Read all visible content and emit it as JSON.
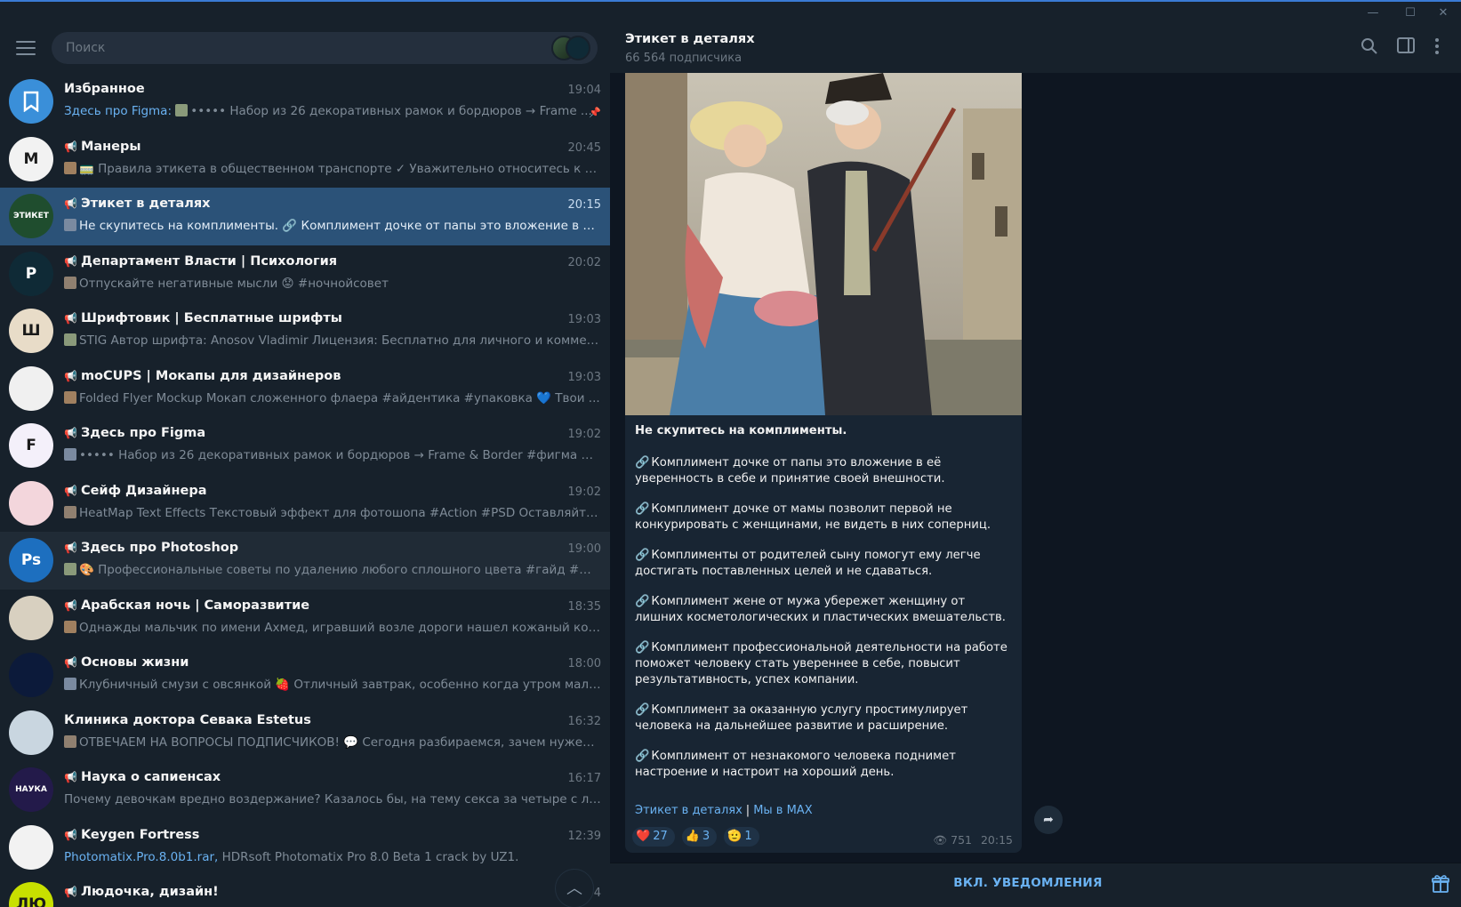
{
  "search": {
    "placeholder": "Поиск"
  },
  "chats": [
    {
      "name": "Избранное",
      "time": "19:04",
      "prefix": "Здесь про Figma:",
      "preview": "••••• Набор из 26 декоративных рамок и бордюров → Frame ...",
      "channel": false,
      "avatar_color": "#3a8fd9",
      "avatar_icon": "bookmark-icon"
    },
    {
      "name": "Манеры",
      "time": "20:45",
      "prefix": "",
      "preview": "🚃 Правила этикета в общественном транспорте ✓ Уважительно относитесь к другим па...",
      "channel": true,
      "avatar_color": "#f2f2f2",
      "avatar_text": "M"
    },
    {
      "name": "Этикет в деталях",
      "time": "20:15",
      "prefix": "",
      "preview": "Не скупитесь на комплименты. 🔗 Комплимент дочке от папы это вложение в её увере...",
      "channel": true,
      "avatar_color": "#1f4d2e",
      "avatar_text": "ЭТИКЕТ"
    },
    {
      "name": "Департамент Власти | Психология",
      "time": "20:02",
      "prefix": "",
      "preview": "Отпускайте негативные мысли 😟 #ночнойсовет",
      "channel": true,
      "avatar_color": "#0f2a36",
      "avatar_text": "P"
    },
    {
      "name": "Шрифтовик | Бесплатные шрифты",
      "time": "19:03",
      "prefix": "",
      "preview": "STIG Автор шрифта: Anosov Vladimir Лицензия: Бесплатно для личного и коммер...",
      "channel": true,
      "avatar_color": "#e8dcc8",
      "avatar_text": "Ш"
    },
    {
      "name": "moCUPS | Мокапы для дизайнеров",
      "time": "19:03",
      "prefix": "",
      "preview": "Folded Flyer Mockup Мокап сложенного флаера #айдентика #упаковка 💙 Твои ...",
      "channel": true,
      "avatar_color": "#f0f0f0",
      "avatar_text": ""
    },
    {
      "name": "Здесь про Figma",
      "time": "19:02",
      "prefix": "",
      "preview": "••••• Набор из 26 декоративных рамок и бордюров → Frame & Border #фигма #по...",
      "channel": true,
      "avatar_color": "#f4f0fa",
      "avatar_text": "F"
    },
    {
      "name": "Сейф Дизайнера",
      "time": "19:02",
      "prefix": "",
      "preview": "HeatMap Text Effects Текстовый эффект для фотошопа #Action #PSD Оставляйте❤️ ре...",
      "channel": true,
      "avatar_color": "#f3d6dc",
      "avatar_text": ""
    },
    {
      "name": "Здесь про Photoshop",
      "time": "19:00",
      "prefix": "",
      "preview": "🎨 Профессиональные советы по удалению любого сплошного цвета #гайд #фотошоп...",
      "channel": true,
      "avatar_color": "#1d6fbf",
      "avatar_text": "Ps"
    },
    {
      "name": "Арабская ночь | Саморазвитие",
      "time": "18:35",
      "prefix": "",
      "preview": "Однажды мальчик по имени Ахмед, игравший возле дороги нашел кожаный кошелек, ...",
      "channel": true,
      "avatar_color": "#d8d0c0",
      "avatar_text": ""
    },
    {
      "name": "Основы жизни",
      "time": "18:00",
      "prefix": "",
      "preview": "Клубничный смузи с овсянкой 🍓 Отличный завтрак, особенно когда утром мало вре...",
      "channel": true,
      "avatar_color": "#0c1a3a",
      "avatar_text": ""
    },
    {
      "name": "Клиника доктора Севака Estetus",
      "time": "16:32",
      "prefix": "",
      "preview": "ОТВЕЧАЕМ НА ВОПРОСЫ ПОДПИСЧИКОВ! 💬 Сегодня разбираемся, зачем нужен ирри...",
      "channel": false,
      "avatar_color": "#c9d6e0",
      "avatar_text": ""
    },
    {
      "name": "Наука о сапиенсах",
      "time": "16:17",
      "prefix": "",
      "preview": "Почему девочкам вредно воздержание? Казалось бы, на тему секса за четыре с лишним г...",
      "channel": true,
      "avatar_color": "#231a4a",
      "avatar_text": "НАУКА"
    },
    {
      "name": "Keygen Fortress",
      "time": "12:39",
      "prefix": "Photomatix.Pro.8.0b1.rar,",
      "preview": " HDRsoft Photomatix Pro 8.0 Beta 1 crack by UZ1.",
      "channel": true,
      "avatar_color": "#f2f2f2",
      "avatar_text": ""
    },
    {
      "name": "Людочка, дизайн!",
      "time": "4",
      "prefix": "",
      "preview": "",
      "channel": true,
      "avatar_color": "#c8e000",
      "avatar_text": "ЛЮ"
    }
  ],
  "channel": {
    "title": "Этикет в деталях",
    "subscribers": "66 564 подписчика"
  },
  "post": {
    "headline": "Не скупитесь на комплименты.",
    "paragraphs": [
      "Комплимент дочке от папы это вложение в её уверенность в себе и принятие своей внешности.",
      "Комплимент дочке от мамы позволит первой не конкурировать с женщинами, не видеть в них соперниц.",
      "Комплименты от родителей сыну помогут ему легче достигать поставленных целей и не сдаваться.",
      "Комплимент жене от мужа убережет женщину от лишних косметологических и пластических вмешательств.",
      "Комплимент профессиональной деятельности на работе поможет человеку стать увереннее в себе, повысит результативность, успех компании.",
      "Комплимент за оказанную услугу простимулирует человека на дальнейшее развитие и расширение.",
      "Комплимент от незнакомого человека поднимет настроение и настроит на хороший день."
    ],
    "link1": "Этикет в деталях",
    "link_sep": "|",
    "link2": "Мы в MAX",
    "reactions": [
      {
        "emoji": "❤️",
        "count": "27"
      },
      {
        "emoji": "👍",
        "count": "3"
      },
      {
        "emoji": "🫡",
        "count": "1"
      }
    ],
    "views": "751",
    "time": "20:15"
  },
  "bottom": {
    "notify_label": "ВКЛ. УВЕДОМЛЕНИЯ"
  },
  "colors": {
    "accent": "#6ab2f2",
    "active_row": "#2b5278",
    "panel": "#17212b",
    "background": "#0e1621"
  }
}
